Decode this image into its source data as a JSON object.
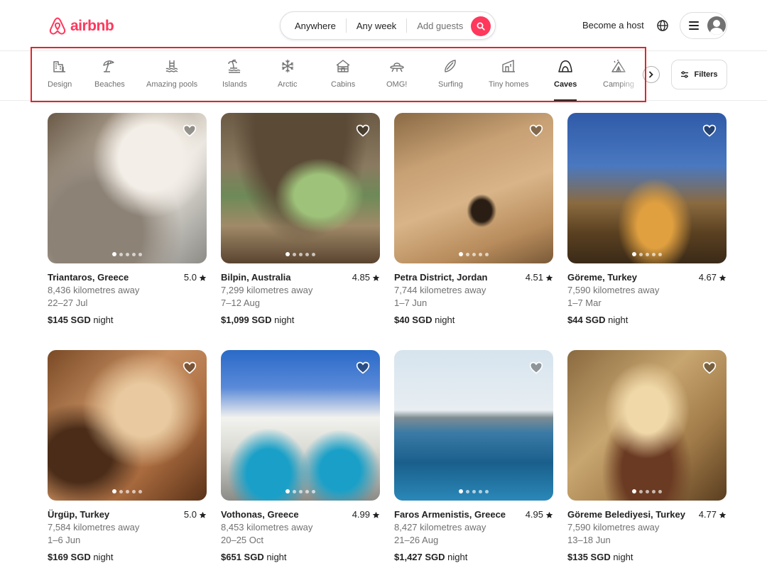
{
  "header": {
    "logo_text": "airbnb",
    "brand_color": "#ff385c",
    "search": {
      "where": "Anywhere",
      "when": "Any week",
      "who": "Add guests"
    },
    "become_host": "Become a host",
    "icons": [
      "globe-icon",
      "menu-icon",
      "avatar-icon",
      "search-icon"
    ]
  },
  "categories": {
    "items": [
      {
        "label": "Design",
        "icon": "design-icon"
      },
      {
        "label": "Beaches",
        "icon": "beach-umbrella-icon"
      },
      {
        "label": "Amazing pools",
        "icon": "pool-icon"
      },
      {
        "label": "Islands",
        "icon": "island-icon"
      },
      {
        "label": "Arctic",
        "icon": "snowflake-icon"
      },
      {
        "label": "Cabins",
        "icon": "cabin-icon"
      },
      {
        "label": "OMG!",
        "icon": "ufo-icon"
      },
      {
        "label": "Surfing",
        "icon": "surfboard-icon"
      },
      {
        "label": "Tiny homes",
        "icon": "tiny-home-icon"
      },
      {
        "label": "Caves",
        "icon": "cave-icon"
      },
      {
        "label": "Camping",
        "icon": "tent-icon"
      }
    ],
    "active": "Caves",
    "filters_label": "Filters"
  },
  "listings": [
    {
      "location": "Triantaros, Greece",
      "rating": "5.0",
      "distance": "8,436 kilometres away",
      "dates": "22–27 Jul",
      "price": "$145 SGD",
      "price_unit": "night"
    },
    {
      "location": "Bilpin, Australia",
      "rating": "4.85",
      "distance": "7,299 kilometres away",
      "dates": "7–12 Aug",
      "price": "$1,099 SGD",
      "price_unit": "night"
    },
    {
      "location": "Petra District, Jordan",
      "rating": "4.51",
      "distance": "7,744 kilometres away",
      "dates": "1–7 Jun",
      "price": "$40 SGD",
      "price_unit": "night"
    },
    {
      "location": "Göreme, Turkey",
      "rating": "4.67",
      "distance": "7,590 kilometres away",
      "dates": "1–7 Mar",
      "price": "$44 SGD",
      "price_unit": "night"
    },
    {
      "location": "Ürgüp, Turkey",
      "rating": "5.0",
      "distance": "7,584 kilometres away",
      "dates": "1–6 Jun",
      "price": "$169 SGD",
      "price_unit": "night"
    },
    {
      "location": "Vothonas, Greece",
      "rating": "4.99",
      "distance": "8,453 kilometres away",
      "dates": "20–25 Oct",
      "price": "$651 SGD",
      "price_unit": "night"
    },
    {
      "location": "Faros Armenistis, Greece",
      "rating": "4.95",
      "distance": "8,427 kilometres away",
      "dates": "21–26 Aug",
      "price": "$1,427 SGD",
      "price_unit": "night"
    },
    {
      "location": "Göreme Belediyesi, Turkey",
      "rating": "4.77",
      "distance": "7,590 kilometres away",
      "dates": "13–18 Jun",
      "price": "$135 SGD",
      "price_unit": "night"
    }
  ]
}
